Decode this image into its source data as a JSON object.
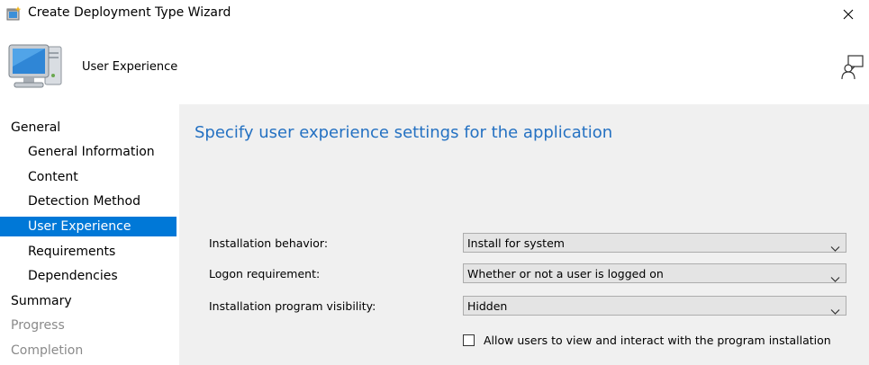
{
  "window": {
    "title": "Create Deployment Type Wizard",
    "icon": "wizard-app-icon",
    "close_icon": "close-icon"
  },
  "header": {
    "title": "User Experience",
    "icon": "computer-icon",
    "feedback_icon": "feedback-person-icon"
  },
  "nav": {
    "items": [
      {
        "label": "General",
        "level": 0,
        "state": "normal"
      },
      {
        "label": "General Information",
        "level": 1,
        "state": "normal"
      },
      {
        "label": "Content",
        "level": 1,
        "state": "normal"
      },
      {
        "label": "Detection Method",
        "level": 1,
        "state": "normal"
      },
      {
        "label": "User Experience",
        "level": 1,
        "state": "selected"
      },
      {
        "label": "Requirements",
        "level": 1,
        "state": "normal"
      },
      {
        "label": "Dependencies",
        "level": 1,
        "state": "normal"
      },
      {
        "label": "Summary",
        "level": 0,
        "state": "normal"
      },
      {
        "label": "Progress",
        "level": 0,
        "state": "disabled"
      },
      {
        "label": "Completion",
        "level": 0,
        "state": "disabled"
      }
    ]
  },
  "content": {
    "heading": "Specify user experience settings for the application",
    "fields": [
      {
        "label": "Installation behavior:",
        "value": "Install for system"
      },
      {
        "label": "Logon requirement:",
        "value": "Whether or not a user is logged on"
      },
      {
        "label": "Installation program visibility:",
        "value": "Hidden"
      }
    ],
    "checkbox": {
      "label": "Allow users to view and interact with the program installation",
      "checked": false
    }
  },
  "colors": {
    "accent": "#0078d7",
    "heading": "#2471c2",
    "panel_background": "#f0f0f0",
    "disabled_text": "#8a8a8a"
  }
}
